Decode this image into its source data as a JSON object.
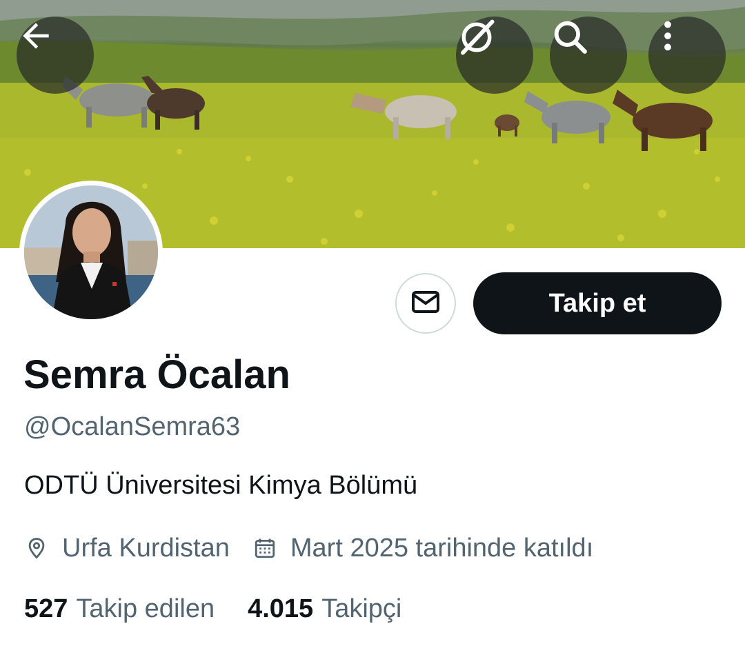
{
  "header": {
    "back_icon": "arrow-left-icon",
    "grok_icon": "grok-icon",
    "search_icon": "search-icon",
    "more_icon": "more-vertical-icon"
  },
  "profile": {
    "name": "Semra Öcalan",
    "handle": "@OcalanSemra63",
    "bio": "ODTÜ Üniversitesi Kimya Bölümü",
    "location": "Urfa Kurdistan",
    "joined": "Mart 2025 tarihinde katıldı",
    "following_count": "527",
    "following_label": "Takip edilen",
    "followers_count": "4.015",
    "followers_label": "Takipçi"
  },
  "actions": {
    "message_icon": "envelope-icon",
    "follow_label": "Takip et"
  },
  "colors": {
    "text_primary": "#0f1419",
    "text_secondary": "#536471",
    "follow_button_bg": "#0f1419",
    "border": "#cfd9de"
  }
}
